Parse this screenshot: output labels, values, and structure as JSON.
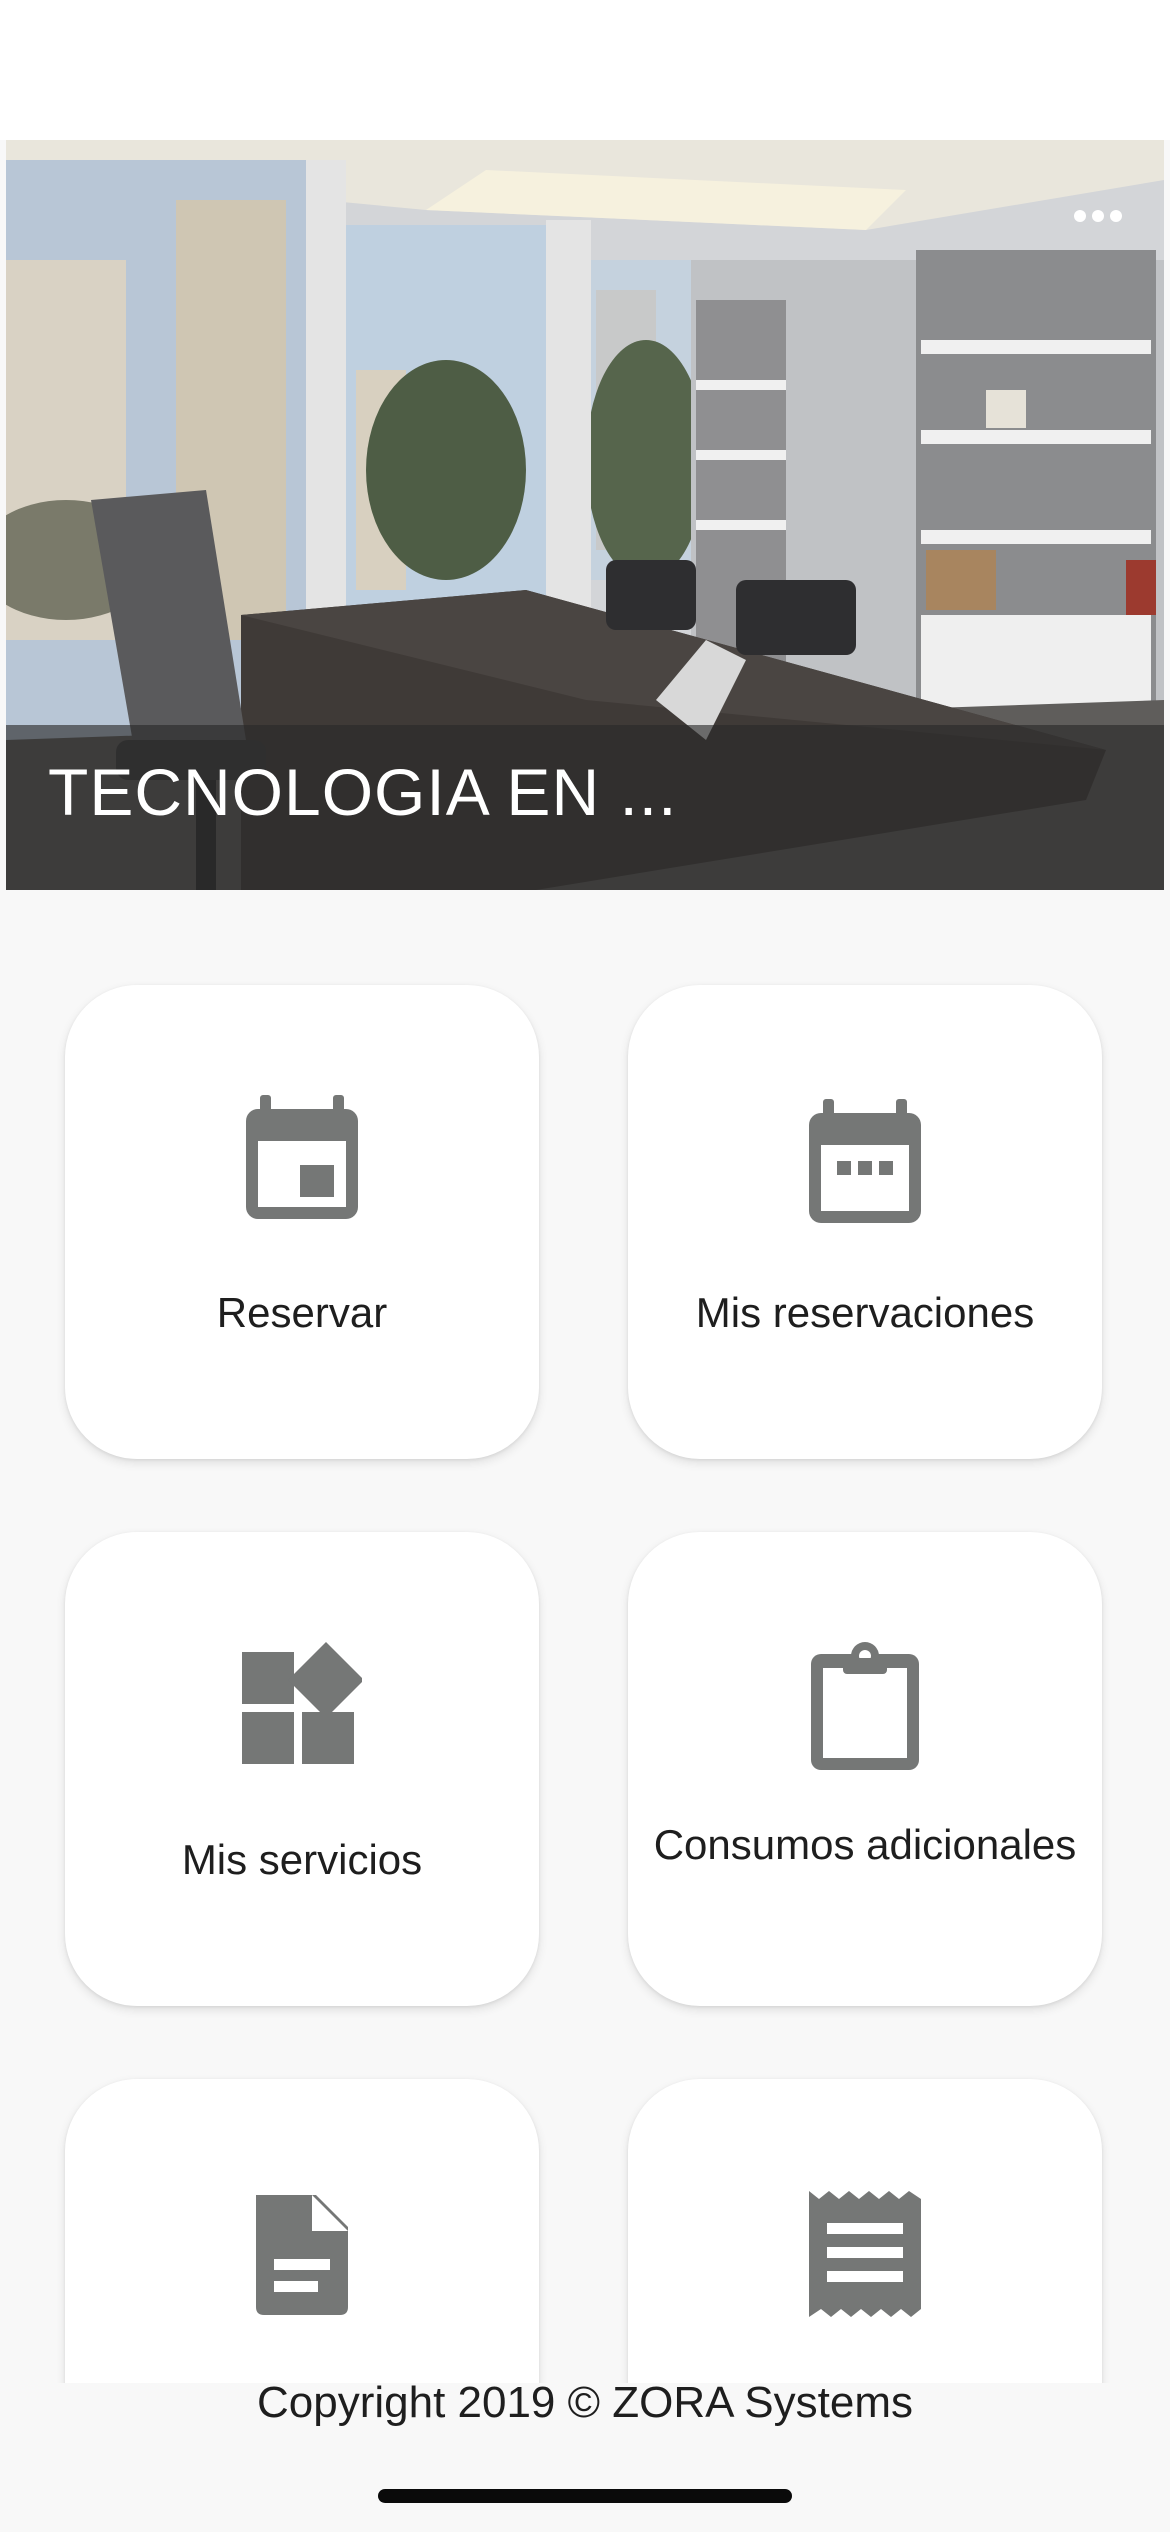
{
  "hero": {
    "title": "TECNOLOGIA EN ...",
    "more_icon": "more-horizontal-icon"
  },
  "menu": [
    {
      "id": "reservar",
      "label": "Reservar",
      "icon": "calendar-event-icon"
    },
    {
      "id": "mis-reservaciones",
      "label": "Mis reservaciones",
      "icon": "calendar-view-icon"
    },
    {
      "id": "mis-servicios",
      "label": "Mis servicios",
      "icon": "widgets-icon"
    },
    {
      "id": "consumos-adicionales",
      "label": "Consumos adicionales",
      "icon": "clipboard-icon"
    },
    {
      "id": "documento",
      "label": "",
      "icon": "document-icon"
    },
    {
      "id": "recibo",
      "label": "",
      "icon": "receipt-icon"
    }
  ],
  "footer": {
    "copyright": "Copyright 2019 © ZORA Systems"
  },
  "colors": {
    "icon_gray": "#757776",
    "card_bg": "#ffffff",
    "page_bg": "#f8f8f8"
  }
}
